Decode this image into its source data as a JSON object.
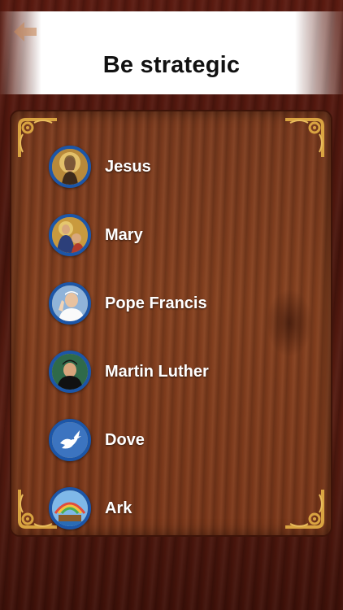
{
  "header": {
    "title": "Be strategic",
    "back_icon": "back-arrow-icon"
  },
  "list": {
    "items": [
      {
        "label": "Jesus",
        "icon": "jesus-icon"
      },
      {
        "label": "Mary",
        "icon": "mary-icon"
      },
      {
        "label": "Pope Francis",
        "icon": "pope-francis-icon"
      },
      {
        "label": "Martin Luther",
        "icon": "martin-luther-icon"
      },
      {
        "label": "Dove",
        "icon": "dove-icon"
      },
      {
        "label": "Ark",
        "icon": "ark-icon"
      }
    ]
  },
  "colors": {
    "avatar_ring": "#1c56a8",
    "wood": "#7a3a1e",
    "ornament": "#d9a441"
  }
}
